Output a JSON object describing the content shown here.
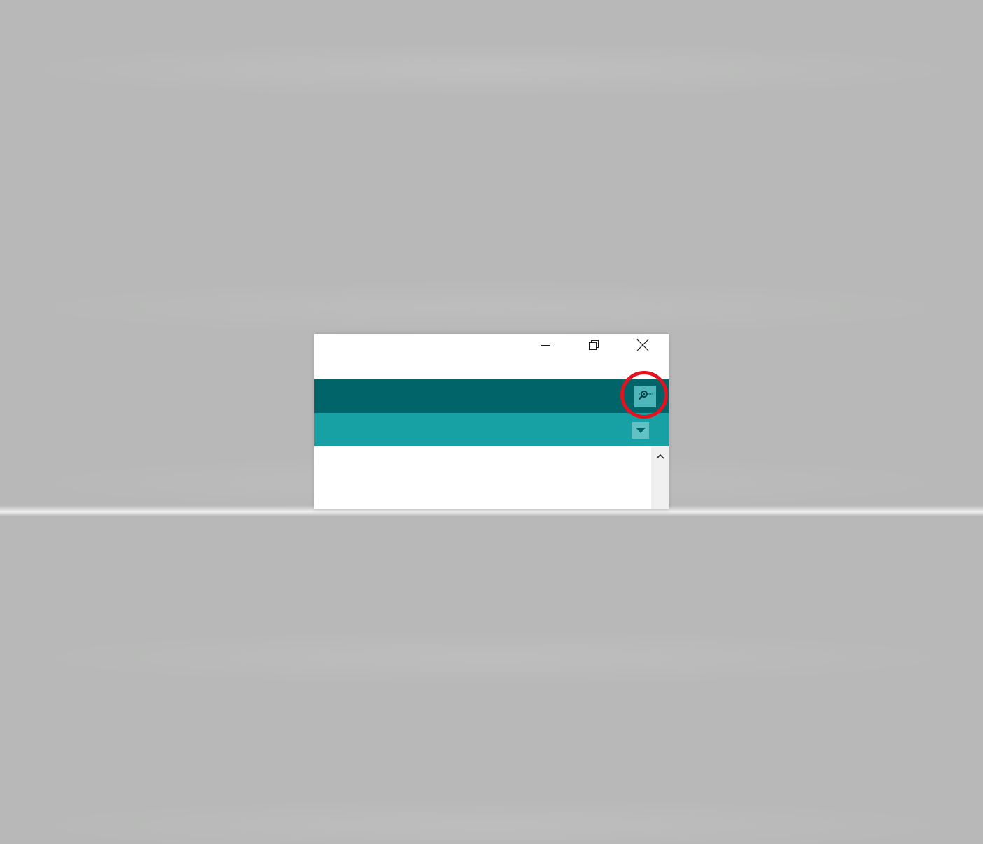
{
  "window": {
    "title": "",
    "controls": {
      "minimize_icon": "minimize-icon",
      "restore_icon": "restore-icon",
      "close_icon": "close-icon"
    }
  },
  "toolbar": {
    "serial_monitor_icon": "serial-monitor-icon",
    "background_color": "#006468",
    "button_color": "#4db7bb"
  },
  "tabbar": {
    "menu_icon": "chevron-down-icon",
    "background_color": "#17a1a5"
  },
  "annotation": {
    "highlight_color": "#e3121f"
  },
  "scrollbar": {
    "up_icon": "chevron-up-icon"
  }
}
